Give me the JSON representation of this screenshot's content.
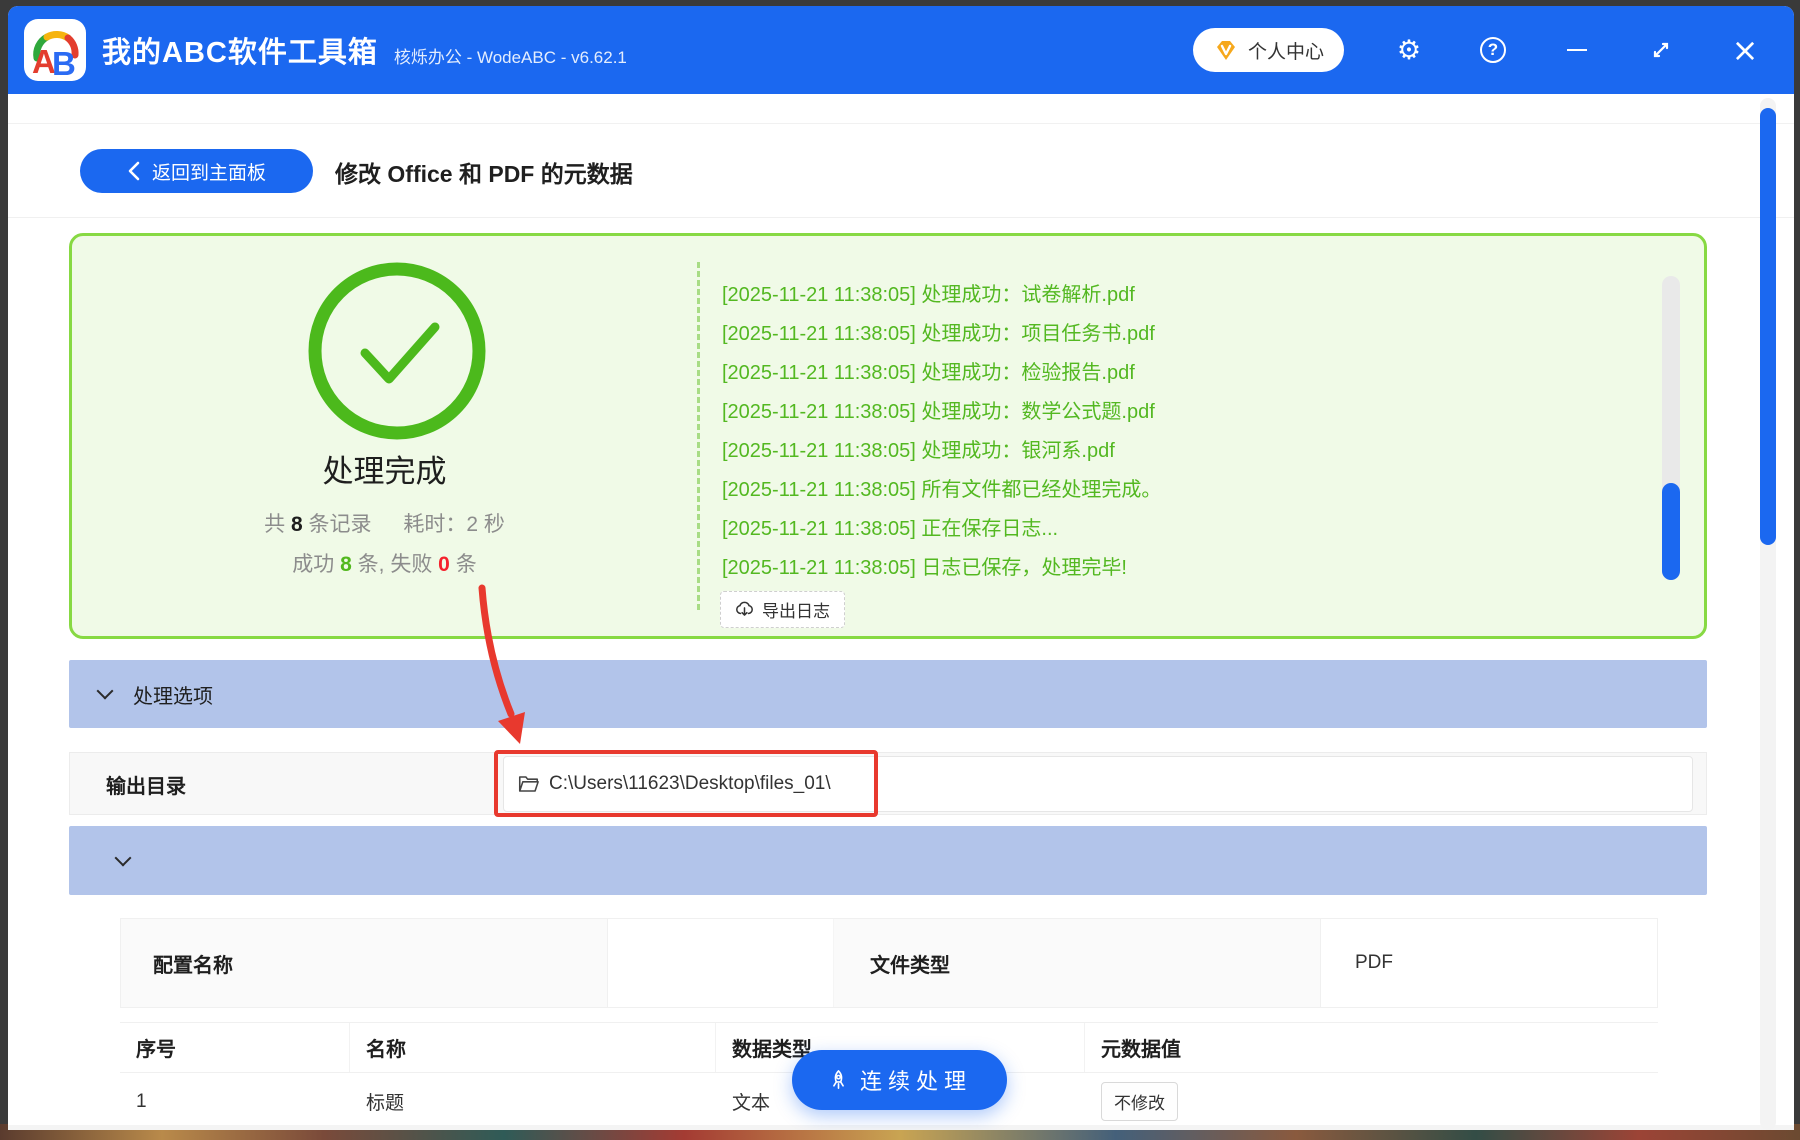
{
  "colors": {
    "accent": "#1B68F0",
    "success_green": "#53B821",
    "fail_red": "#F5222D",
    "panel_border_green": "#87D943",
    "panel_bg_green": "#F0FAE7",
    "section_header_bg": "#B2C4EA",
    "annotation_red": "#E8392E",
    "gem_orange": "#F6A81C"
  },
  "titlebar": {
    "logo_text": "AB",
    "app_title": "我的ABC软件工具箱",
    "subtitle": "核烁办公 - WodeABC - v6.62.1",
    "user_center_label": "个人中心"
  },
  "page": {
    "back_label": "返回到主面板",
    "title": "修改 Office 和 PDF 的元数据"
  },
  "result_panel": {
    "status": "处理完成",
    "stat_total_prefix": "共",
    "stat_total": "8",
    "stat_total_suffix": "条记录",
    "stat_time": "耗时：2 秒",
    "stat_success_prefix": "成功",
    "stat_success": "8",
    "stat_middle": "条, 失败",
    "stat_fail": "0",
    "stat_fail_suffix": "条",
    "logs": [
      "[2025-11-21 11:38:05] 处理成功：试卷解析.pdf",
      "[2025-11-21 11:38:05] 处理成功：项目任务书.pdf",
      "[2025-11-21 11:38:05] 处理成功：检验报告.pdf",
      "[2025-11-21 11:38:05] 处理成功：数学公式题.pdf",
      "[2025-11-21 11:38:05] 处理成功：银河系.pdf",
      "[2025-11-21 11:38:05] 所有文件都已经处理完成。",
      "[2025-11-21 11:38:05] 正在保存日志...",
      "[2025-11-21 11:38:05] 日志已保存，处理完毕!"
    ],
    "export_label": "导出日志"
  },
  "options": {
    "section_title": "处理选项",
    "output_dir_label": "输出目录",
    "output_dir_value": "C:\\Users\\11623\\Desktop\\files_01\\"
  },
  "config": {
    "name_label": "配置名称",
    "name_value": "",
    "type_label": "文件类型",
    "type_value": "PDF"
  },
  "table": {
    "headers": [
      "序号",
      "名称",
      "数据类型",
      "元数据值"
    ],
    "rows": [
      {
        "index": "1",
        "name": "标题",
        "type": "文本",
        "value": "不修改"
      }
    ]
  },
  "actions": {
    "continue_label": "连续处理"
  }
}
